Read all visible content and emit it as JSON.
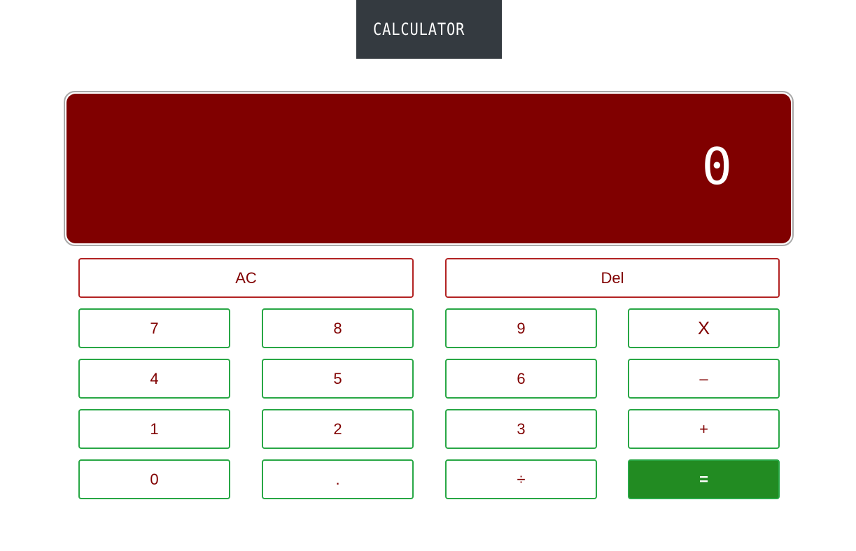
{
  "header": {
    "title": "CALCULATOR"
  },
  "display": {
    "value": "0"
  },
  "buttons": {
    "clear": "AC",
    "delete": "Del",
    "seven": "7",
    "eight": "8",
    "nine": "9",
    "multiply": "X",
    "four": "4",
    "five": "5",
    "six": "6",
    "subtract": "–",
    "one": "1",
    "two": "2",
    "three": "3",
    "add": "+",
    "zero": "0",
    "decimal": ".",
    "divide": "÷",
    "equals": "="
  },
  "colors": {
    "header_bg": "#343a40",
    "display_bg": "#800000",
    "text": "#800000",
    "clear_border": "#b22222",
    "button_border": "#28a745",
    "equals_bg": "#228b22"
  }
}
